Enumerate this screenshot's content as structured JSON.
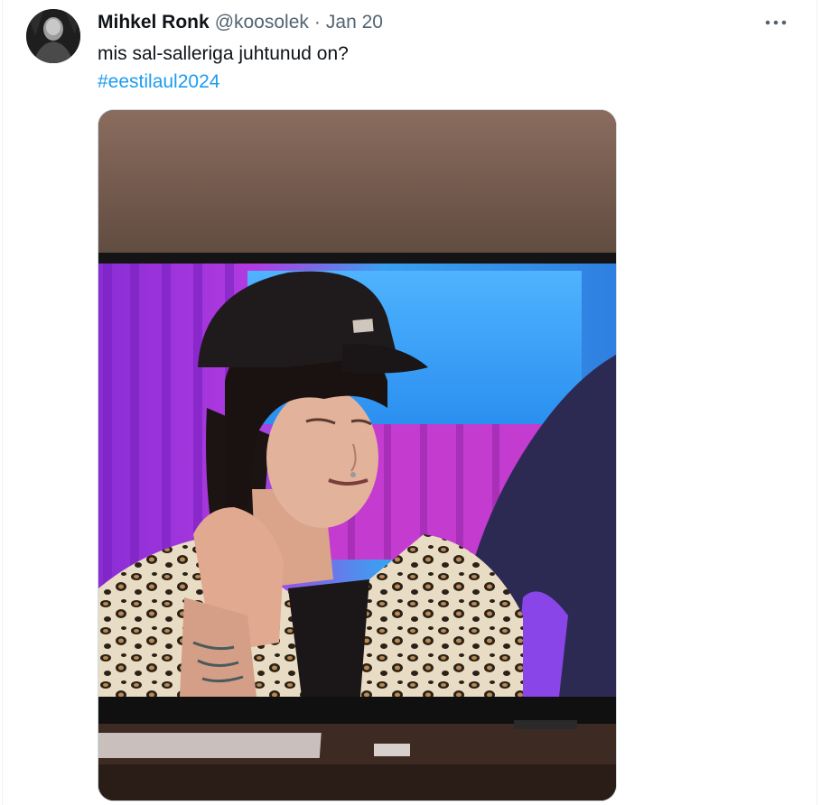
{
  "tweet": {
    "author_name": "Mihkel Ronk",
    "handle": "@koosolek",
    "separator": "·",
    "date": "Jan 20",
    "text": "mis sal-salleriga juhtunud on?",
    "hashtag": "#eestilaul2024"
  },
  "icons": {
    "more": "more-horizontal-icon",
    "avatar": "avatar-photo"
  },
  "colors": {
    "text_primary": "#0f1419",
    "text_secondary": "#536471",
    "link": "#1d9bf0",
    "border": "#cfd9de"
  }
}
